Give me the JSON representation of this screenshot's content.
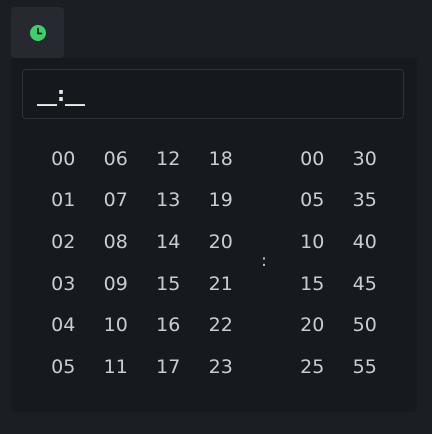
{
  "toggle": {
    "icon": "clock-icon",
    "accent": "#3fcf6a"
  },
  "input": {
    "value": "__:__"
  },
  "separator": ":",
  "hours": [
    "00",
    "01",
    "02",
    "03",
    "04",
    "05",
    "06",
    "07",
    "08",
    "09",
    "10",
    "11",
    "12",
    "13",
    "14",
    "15",
    "16",
    "17",
    "18",
    "19",
    "20",
    "21",
    "22",
    "23"
  ],
  "minutes": [
    "00",
    "05",
    "10",
    "15",
    "20",
    "25",
    "30",
    "35",
    "40",
    "45",
    "50",
    "55"
  ]
}
